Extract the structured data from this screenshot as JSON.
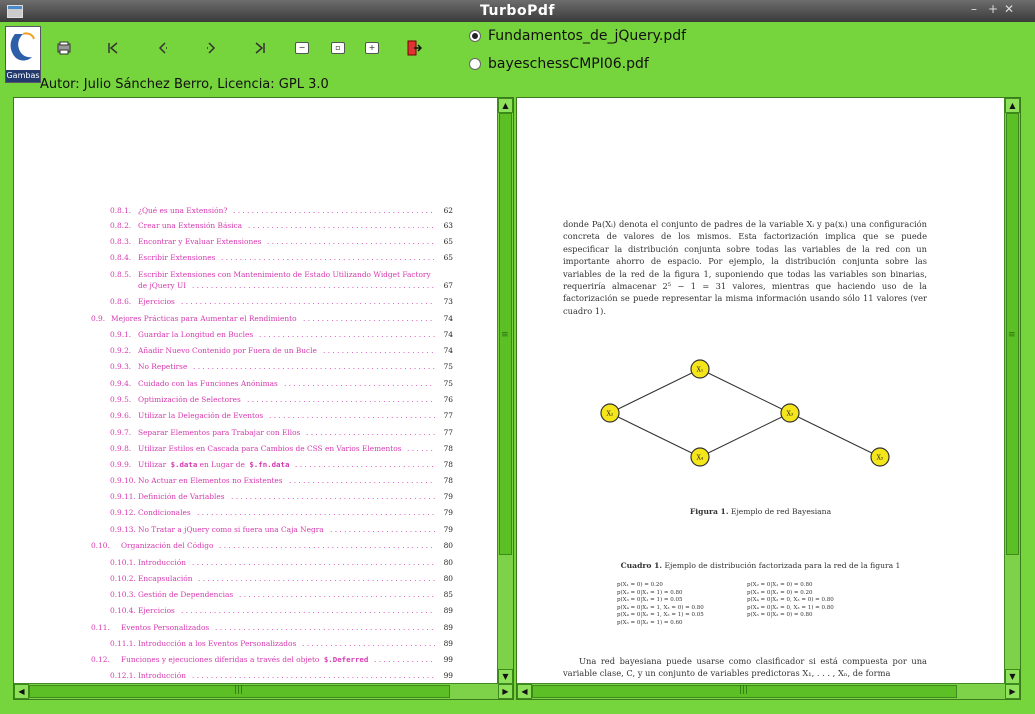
{
  "window": {
    "title": "TurboPdf",
    "logo_text": "Gambas"
  },
  "author": "Autor: Julio Sánchez Berro, Licencia: GPL 3.0",
  "files": [
    {
      "label": "Fundamentos_de_jQuery.pdf",
      "selected": true
    },
    {
      "label": "bayeschessCMPI06.pdf",
      "selected": false
    }
  ],
  "toolbar": [
    {
      "icon": "print-icon"
    },
    {
      "icon": "first-page-icon",
      "glyph": "⏮"
    },
    {
      "icon": "previous-page-icon",
      "glyph": "‹"
    },
    {
      "icon": "next-page-icon",
      "glyph": "›"
    },
    {
      "icon": "last-page-icon",
      "glyph": "⏭"
    },
    {
      "icon": "zoom-out-icon",
      "glyph": "−"
    },
    {
      "icon": "fit-page-icon",
      "glyph": "⛶"
    },
    {
      "icon": "zoom-in-icon",
      "glyph": "+"
    },
    {
      "icon": "exit-icon"
    }
  ],
  "toc": [
    {
      "num": "0.8.1.",
      "text": "¿Qué es una Extensión?",
      "page": "62",
      "level": 2
    },
    {
      "num": "0.8.2.",
      "text": "Crear una Extensión Básica",
      "page": "63",
      "level": 2
    },
    {
      "num": "0.8.3.",
      "text": "Encontrar y Evaluar Extensiones",
      "page": "65",
      "level": 2
    },
    {
      "num": "0.8.4.",
      "text": "Escribir Extensiones",
      "page": "65",
      "level": 2
    },
    {
      "num": "0.8.5.",
      "text": "Escribir Extensiones con Mantenimiento de Estado Utilizando Widget Factory",
      "text2": "de jQuery UI",
      "page": "67",
      "level": 2
    },
    {
      "num": "0.8.6.",
      "text": "Ejercicios",
      "page": "73",
      "level": 2
    },
    {
      "num": "0.9.",
      "text": "Mejores Prácticas para Aumentar el Rendimiento",
      "page": "74",
      "level": 1
    },
    {
      "num": "0.9.1.",
      "text": "Guardar la Longitud en Bucles",
      "page": "74",
      "level": 2
    },
    {
      "num": "0.9.2.",
      "text": "Añadir Nuevo Contenido por Fuera de un Bucle",
      "page": "74",
      "level": 2
    },
    {
      "num": "0.9.3.",
      "text": "No Repetirse",
      "page": "75",
      "level": 2
    },
    {
      "num": "0.9.4.",
      "text": "Cuidado con las Funciones Anónimas",
      "page": "75",
      "level": 2
    },
    {
      "num": "0.9.5.",
      "text": "Optimización de Selectores",
      "page": "76",
      "level": 2
    },
    {
      "num": "0.9.6.",
      "text": "Utilizar la Delegación de Eventos",
      "page": "77",
      "level": 2
    },
    {
      "num": "0.9.7.",
      "text": "Separar Elementos para Trabajar con Ellos",
      "page": "77",
      "level": 2
    },
    {
      "num": "0.9.8.",
      "text": "Utilizar Estilos en Cascada para Cambios de CSS en Varios Elementos",
      "page": "78",
      "level": 2
    },
    {
      "num": "0.9.9.",
      "text": "Utilizar",
      "code1": "$.data",
      "mid": "en Lugar de",
      "code2": "$.fn.data",
      "page": "78",
      "level": 2
    },
    {
      "num": "0.9.10.",
      "text": "No Actuar en Elementos no Existentes",
      "page": "78",
      "level": 2
    },
    {
      "num": "0.9.11.",
      "text": "Definición de Variables",
      "page": "79",
      "level": 2
    },
    {
      "num": "0.9.12.",
      "text": "Condicionales",
      "page": "79",
      "level": 2
    },
    {
      "num": "0.9.13.",
      "text": "No Tratar a jQuery como si fuera una Caja Negra",
      "page": "79",
      "level": 2
    },
    {
      "num": "0.10.",
      "text": "Organización del Código",
      "page": "80",
      "level": 1
    },
    {
      "num": "0.10.1.",
      "text": "Introducción",
      "page": "80",
      "level": 2
    },
    {
      "num": "0.10.2.",
      "text": "Encapsulación",
      "page": "80",
      "level": 2
    },
    {
      "num": "0.10.3.",
      "text": "Gestión de Dependencias",
      "page": "85",
      "level": 2
    },
    {
      "num": "0.10.4.",
      "text": "Ejercicios",
      "page": "89",
      "level": 2
    },
    {
      "num": "0.11.",
      "text": "Eventos Personalizados",
      "page": "89",
      "level": 1
    },
    {
      "num": "0.11.1.",
      "text": "Introducción a los Eventos Personalizados",
      "page": "89",
      "level": 2
    },
    {
      "num": "0.12.",
      "text": "Funciones y ejecuciones diferidas a través del objeto",
      "code1": "$.Deferred",
      "page": "99",
      "level": 1
    },
    {
      "num": "0.12.1.",
      "text": "Introducción",
      "page": "99",
      "level": 2
    }
  ],
  "doc": {
    "paragraph1": "donde Pa(Xᵢ) denota el conjunto de padres de la variable Xᵢ y pa(xᵢ) una configuración concreta de valores de los mismos. Esta factorización implica que se puede especificar la distribución conjunta sobre todas las variables de la red con un importante ahorro de espacio. Por ejemplo, la distribución conjunta sobre las variables de la red de la figura 1, suponiendo que todas las variables son binarias, requeriría almacenar 2⁵ − 1 = 31 valores, mientras que haciendo uso de la factorización se puede representar la misma información usando sólo 11 valores (ver cuadro 1).",
    "nodes": [
      "X₁",
      "X₂",
      "X₃",
      "X₄",
      "X₅"
    ],
    "figure_caption_bold": "Figura 1.",
    "figure_caption": "Ejemplo de red Bayesiana",
    "table_caption_bold": "Cuadro 1.",
    "table_caption": "Ejemplo de distribución factorizada para la red de la figura 1",
    "formulas_left": [
      "p(X₁ = 0) = 0.20",
      "p(X₂ = 0|X₁ = 1) = 0.80",
      "p(X₃ = 0|X₁ = 1) = 0.05",
      "p(X₄ = 0|X₂ = 1, X₃ = 0) = 0.80",
      "p(X₄ = 0|X₂ = 1, X₃ = 1) = 0.05",
      "p(X₅ = 0|X₃ = 1) = 0.60"
    ],
    "formulas_right": [
      "p(X₂ = 0|X₁ = 0) = 0.80",
      "p(X₃ = 0|X₁ = 0) = 0.20",
      "p(X₄ = 0|X₂ = 0, X₃ = 0) = 0.80",
      "p(X₄ = 0|X₂ = 0, X₃ = 1) = 0.80",
      "p(X₅ = 0|X₃ = 0) = 0.80"
    ],
    "paragraph2": "Una red bayesiana puede usarse como clasificador si está compuesta por una variable clase, C, y un conjunto de variables predictoras X₁, . . . , Xₙ, de forma"
  },
  "colors": {
    "window_bg": "#76d43c",
    "toc_text": "#d63ab0",
    "node_fill": "#f5e51b"
  }
}
